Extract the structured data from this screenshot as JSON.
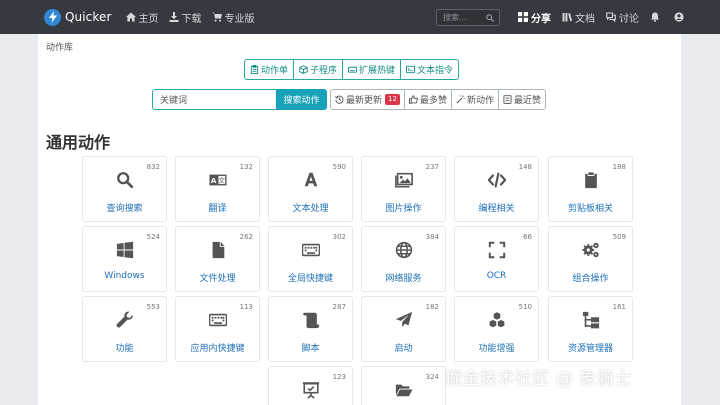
{
  "nav": {
    "brand": "Quicker",
    "links": [
      {
        "label": "主页",
        "icon": "home-icon"
      },
      {
        "label": "下载",
        "icon": "download-icon"
      },
      {
        "label": "专业版",
        "icon": "cart-icon"
      }
    ],
    "search_placeholder": "搜索...",
    "right": [
      {
        "label": "分享",
        "icon": "grid-icon",
        "active": true
      },
      {
        "label": "文档",
        "icon": "book-icon"
      },
      {
        "label": "讨论",
        "icon": "comments-icon"
      }
    ]
  },
  "breadcrumb": "动作库",
  "type_tabs": [
    "动作单",
    "子程序",
    "扩展热键",
    "文本指令"
  ],
  "search": {
    "value": "关键词",
    "button": "搜索动作"
  },
  "sort_tabs": [
    {
      "label": "最新更新",
      "badge": "12"
    },
    {
      "label": "最多赞"
    },
    {
      "label": "新动作"
    },
    {
      "label": "最近赞"
    }
  ],
  "section_title": "通用动作",
  "categories": [
    {
      "label": "查询搜索",
      "count": "832",
      "icon": "search-icon"
    },
    {
      "label": "翻译",
      "count": "132",
      "icon": "translate-icon"
    },
    {
      "label": "文本处理",
      "count": "590",
      "icon": "font-icon"
    },
    {
      "label": "图片操作",
      "count": "237",
      "icon": "images-icon"
    },
    {
      "label": "编程相关",
      "count": "148",
      "icon": "code-icon"
    },
    {
      "label": "剪贴板相关",
      "count": "188",
      "icon": "clipboard-icon"
    },
    {
      "label": "Windows",
      "count": "524",
      "icon": "windows-icon"
    },
    {
      "label": "文件处理",
      "count": "262",
      "icon": "file-icon"
    },
    {
      "label": "全局快捷键",
      "count": "302",
      "icon": "keyboard-icon"
    },
    {
      "label": "网络服务",
      "count": "384",
      "icon": "globe-icon"
    },
    {
      "label": "OCR",
      "count": "66",
      "icon": "expand-icon"
    },
    {
      "label": "组合操作",
      "count": "509",
      "icon": "cogs-icon"
    },
    {
      "label": "功能",
      "count": "553",
      "icon": "wrench-icon"
    },
    {
      "label": "应用内快捷键",
      "count": "113",
      "icon": "keyboard-icon"
    },
    {
      "label": "脚本",
      "count": "287",
      "icon": "scroll-icon"
    },
    {
      "label": "启动",
      "count": "182",
      "icon": "paper-plane-icon"
    },
    {
      "label": "功能增强",
      "count": "510",
      "icon": "cubes-icon"
    },
    {
      "label": "资源管理器",
      "count": "161",
      "icon": "sitemap-icon"
    },
    {
      "label": "",
      "count": "123",
      "icon": "presentation-icon"
    },
    {
      "label": "",
      "count": "324",
      "icon": "folder-open-icon"
    }
  ],
  "watermark": "掘金技术社区 @ 象骑士"
}
